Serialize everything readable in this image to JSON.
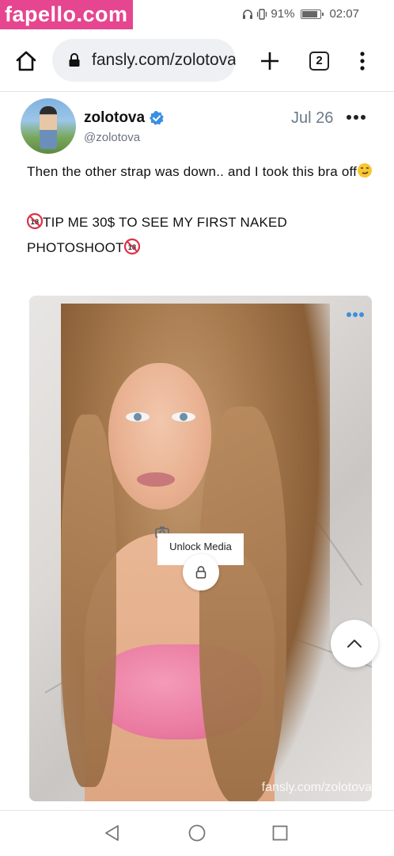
{
  "watermark": {
    "text": "fapello.com",
    "color": "#e5468f"
  },
  "status_bar": {
    "battery": "91%",
    "battery_level": 0.91,
    "time": "02:07"
  },
  "browser": {
    "url": "fansly.com/zolotova",
    "tab_count": "2",
    "icons": [
      "home-icon",
      "lock-icon",
      "plus-icon",
      "tabs-icon",
      "more-vert-icon"
    ]
  },
  "post": {
    "display_name": "zolotova",
    "handle": "@zolotova",
    "date": "Jul 26",
    "verified": true,
    "text_line1": "Then the other strap was down.. and I took this bra off",
    "text_line2": "TIP ME 30$ TO SEE MY FIRST NAKED PHOTOSHOOT",
    "accent_color": "#3b8fe0"
  },
  "media": {
    "unlock_label": "Unlock Media",
    "watermark": "fansly.com/zolotova"
  }
}
